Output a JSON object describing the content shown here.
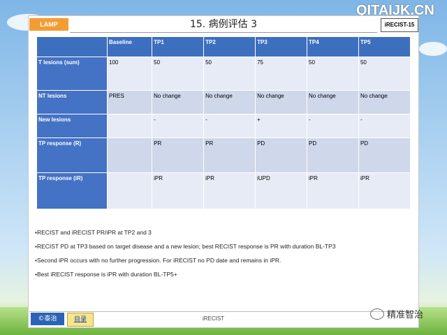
{
  "watermark": "QITAIJK.CN",
  "header": {
    "lamp_label": "LAMP",
    "title": "15. 病例评估 3",
    "tag": "iRECIST-15"
  },
  "table": {
    "columns": [
      "",
      "Baseline",
      "TP1",
      "TP2",
      "TP3",
      "TP4",
      "TP5"
    ],
    "rows": [
      {
        "label": "T lesions (sum)",
        "cells": [
          "100",
          "50",
          "50",
          "75",
          "50",
          "50"
        ]
      },
      {
        "label": "NT lesions",
        "cells": [
          "PRES",
          "No change",
          "No change",
          "No change",
          "No change",
          "No change"
        ]
      },
      {
        "label": "New lesions",
        "cells": [
          "",
          "-",
          "-",
          "+",
          "-",
          "-"
        ]
      },
      {
        "label": "TP response (R)",
        "cells": [
          "",
          "PR",
          "PR",
          "PD",
          "PD",
          "PD"
        ]
      },
      {
        "label": "TP response (iR)",
        "cells": [
          "",
          "iPR",
          "iPR",
          "iUPD",
          "iPR",
          "iPR"
        ]
      }
    ]
  },
  "notes": [
    "•RECIST and iRECIST PR/iPR at TP2 and 3",
    "•RECIST PD at TP3 based on target disease and a new lesion; best RECIST response is PR with duration BL-TP3",
    "•Second iPR occurs with no further progression. For iRECIST no PD date and remains in iPR.",
    "•Best iRECIST response is iPR with duration BL-TP5+"
  ],
  "footer": {
    "logo": "©泰治",
    "toc": "目录",
    "label": "iRECIST",
    "wechat": "精准智治"
  },
  "colors": {
    "header_blue": "#3d6fbf",
    "cell_light": "#e7ebf5",
    "cell_dark": "#cfd7ea",
    "lamp_orange": "#f39c34"
  }
}
